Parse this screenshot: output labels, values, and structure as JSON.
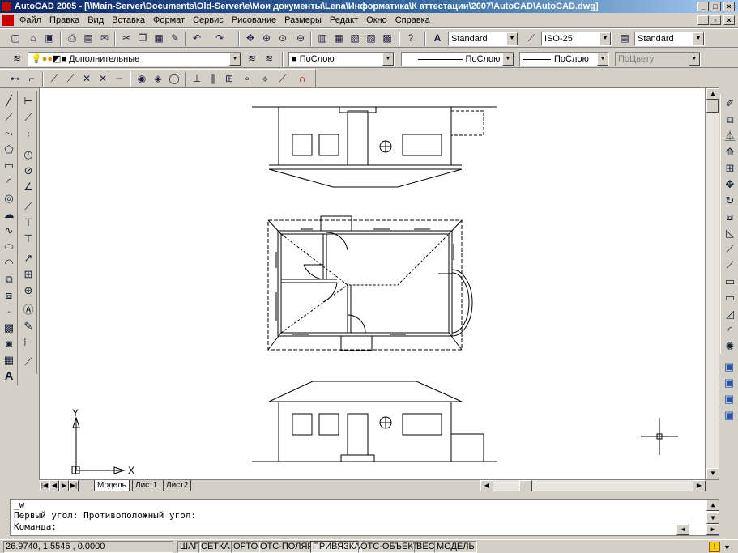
{
  "window": {
    "title": "AutoCAD 2005 - [\\\\Main-Server\\Documents\\Old-Server\\e\\Мои документы\\Lena\\Информатика\\К аттестации\\2007\\AutoCAD\\AutoCAD.dwg]"
  },
  "menu": [
    "Файл",
    "Правка",
    "Вид",
    "Вставка",
    "Формат",
    "Сервис",
    "Рисование",
    "Размеры",
    "Редакт",
    "Окно",
    "Справка"
  ],
  "styles_toolbar": {
    "text_style": "Standard",
    "dim_style": "ISO-25",
    "table_style": "Standard"
  },
  "layers_toolbar": {
    "layer": "Дополнительные",
    "color": "ПоСлою",
    "linetype": "ПоСлою",
    "lineweight": "ПоСлою",
    "plotstyle": "ПоЦвету"
  },
  "ucs": {
    "x_label": "X",
    "y_label": "Y"
  },
  "tabs": [
    "Модель",
    "Лист1",
    "Лист2"
  ],
  "command": {
    "history1": "_w",
    "history2": "Первый угол: Противоположный угол:",
    "prompt": "Команда:"
  },
  "status": {
    "coords": "26.9740, 1.5546 , 0.0000",
    "buttons": [
      "ШАГ",
      "СЕТКА",
      "ОРТО",
      "ОТС-ПОЛЯР",
      "ПРИВЯЗКА",
      "ОТС-ОБЪЕКТ",
      "ВЕС",
      "МОДЕЛЬ"
    ]
  }
}
